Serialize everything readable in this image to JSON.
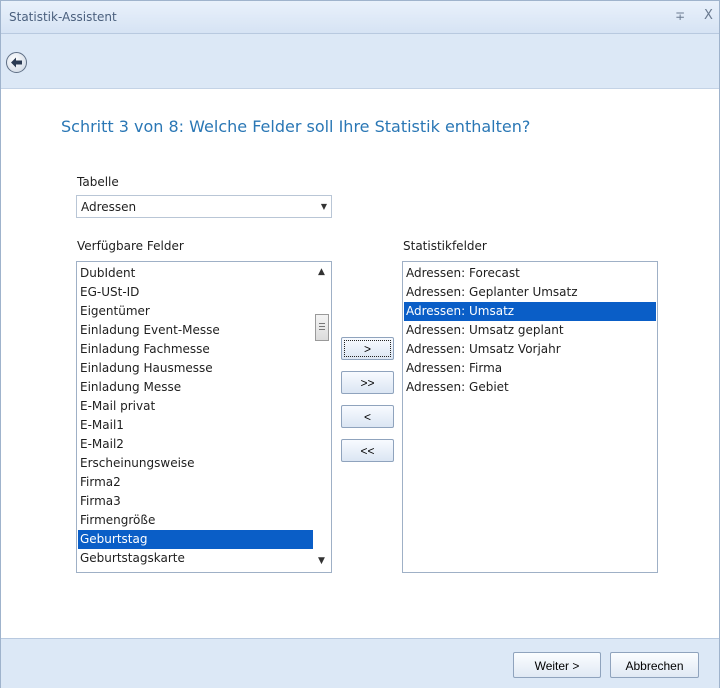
{
  "window": {
    "title": "Statistik-Assistent",
    "pin_symbol": "∓",
    "close_symbol": "X"
  },
  "heading": "Schritt 3 von 8: Welche Felder soll Ihre Statistik enthalten?",
  "table_section": {
    "label": "Tabelle",
    "selected": "Adressen"
  },
  "available": {
    "label": "Verfügbare Felder",
    "items": [
      "DubIdent",
      "EG-USt-ID",
      "Eigentümer",
      "Einladung Event-Messe",
      "Einladung Fachmesse",
      "Einladung Hausmesse",
      "Einladung Messe",
      "E-Mail privat",
      "E-Mail1",
      "E-Mail2",
      "Erscheinungsweise",
      "Firma2",
      "Firma3",
      "Firmengröße",
      "Geburtstag",
      "Geburtstagskarte"
    ],
    "selected_item": "Geburtstag"
  },
  "transfer": {
    "add": ">",
    "add_all": ">>",
    "remove": "<",
    "remove_all": "<<"
  },
  "statistic": {
    "label": "Statistikfelder",
    "items": [
      "Adressen: Forecast",
      "Adressen: Geplanter Umsatz",
      "Adressen: Umsatz",
      "Adressen: Umsatz geplant",
      "Adressen: Umsatz Vorjahr",
      "Adressen: Firma",
      "Adressen: Gebiet"
    ],
    "selected_item": "Adressen: Umsatz"
  },
  "footer": {
    "next": "Weiter >",
    "cancel": "Abbrechen"
  },
  "colors": {
    "accent": "#2a77b5",
    "selection": "#0a5ec7",
    "chrome": "#dce8f6"
  },
  "icons": {
    "back": "back-arrow-icon",
    "pin": "pin-icon",
    "close": "close-icon",
    "dropdown": "chevron-down-icon"
  }
}
